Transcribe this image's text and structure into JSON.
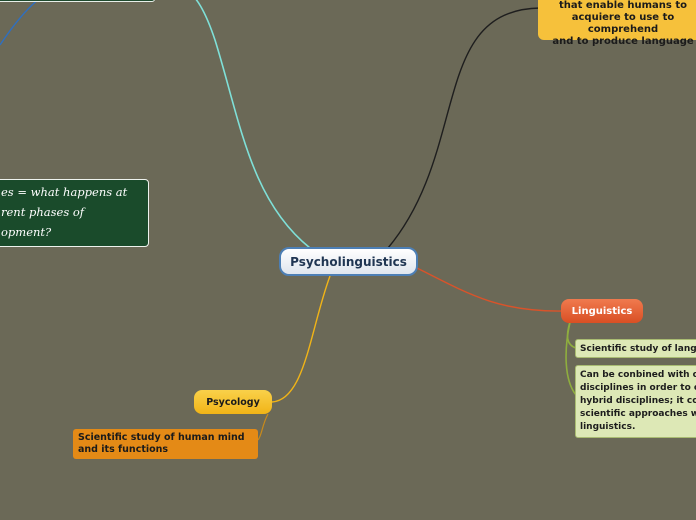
{
  "central": {
    "label": "Psycholinguistics"
  },
  "topright_node": {
    "text": "that enable humans to\nacquiere to use to comprehend\nand to produce language"
  },
  "green_note": {
    "text": "es = what happens at\nrent phases of\nopment?"
  },
  "linguistics": {
    "label": "Linguistics",
    "subtopics": [
      "Scientific study of langu",
      "Can be conbined with o\ndisciplines in order to c\nhybrid disciplines; it co\nscientific approaches w\nlinguistics."
    ]
  },
  "psycology": {
    "label": "Psycology",
    "subtopic": "Scientific study of human mind\nand its functions"
  },
  "colors": {
    "background": "#6b6957",
    "cyan_link": "#7fe0d8",
    "black_link": "#1e1e1e",
    "orange_link": "#d9532a",
    "yellow_link": "#f1b417",
    "green_link": "#8fae3e",
    "blue_link": "#2f6fc0"
  }
}
